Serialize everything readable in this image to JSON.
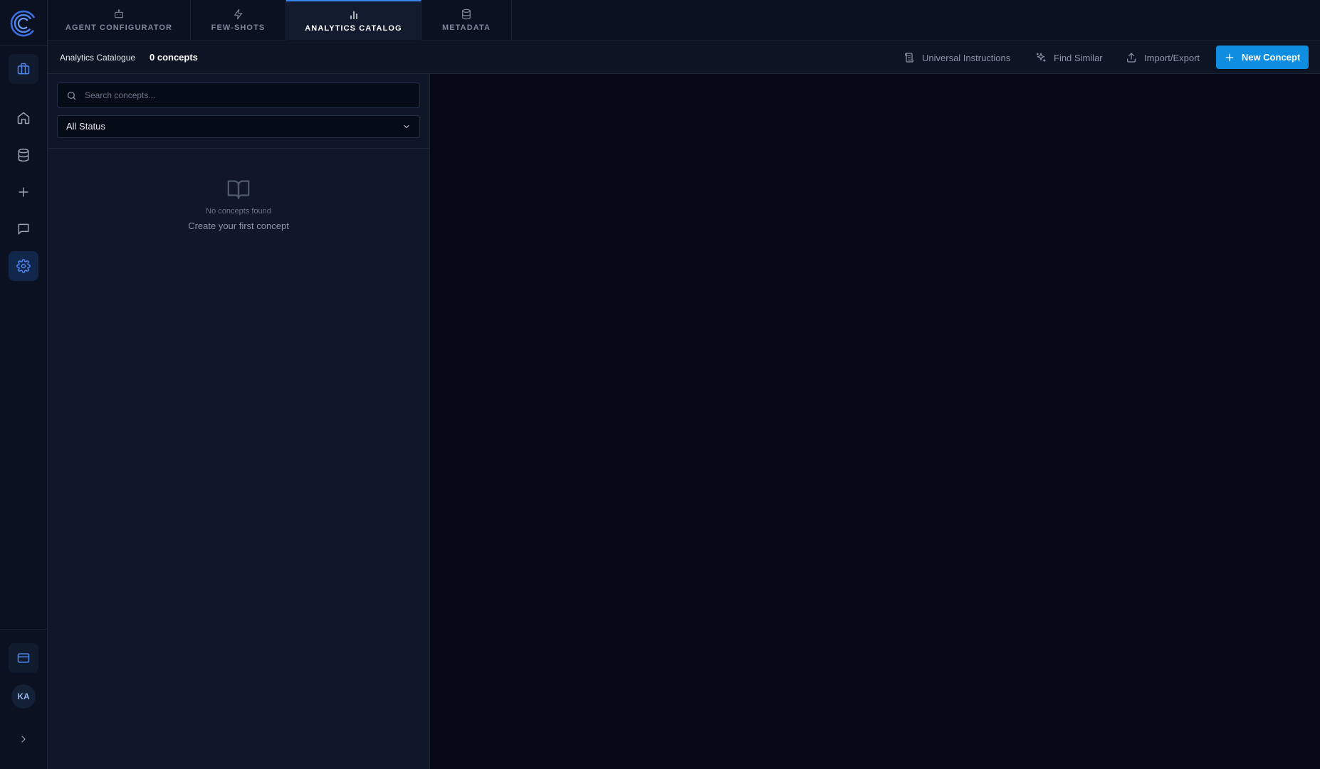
{
  "rail": {
    "logo": "app-logo",
    "items": [
      {
        "name": "briefcase-icon",
        "state": "filled"
      },
      {
        "name": "home-icon",
        "state": "normal"
      },
      {
        "name": "database-icon",
        "state": "normal"
      },
      {
        "name": "plus-icon",
        "state": "normal"
      },
      {
        "name": "chat-icon",
        "state": "normal"
      },
      {
        "name": "gear-icon",
        "state": "active"
      }
    ],
    "bottom_items": [
      {
        "name": "credit-card-icon",
        "state": "filled"
      },
      {
        "name": "chevron-right-icon",
        "state": "normal"
      }
    ],
    "avatar_initials": "KA"
  },
  "tabs": [
    {
      "label": "AGENT CONFIGURATOR",
      "icon": "robot-icon",
      "active": false
    },
    {
      "label": "FEW-SHOTS",
      "icon": "lightning-icon",
      "active": false
    },
    {
      "label": "ANALYTICS CATALOG",
      "icon": "bar-chart-icon",
      "active": true
    },
    {
      "label": "METADATA",
      "icon": "database-icon",
      "active": false
    }
  ],
  "header": {
    "title": "Analytics Catalogue",
    "count": "0 concepts",
    "actions": [
      {
        "label": "Universal Instructions",
        "icon": "scroll-icon"
      },
      {
        "label": "Find Similar",
        "icon": "sparkle-icon"
      },
      {
        "label": "Import/Export",
        "icon": "upload-icon"
      }
    ],
    "primary_button": {
      "label": "New Concept",
      "icon": "plus-icon"
    }
  },
  "panel": {
    "search": {
      "placeholder": "Search concepts...",
      "value": ""
    },
    "status_filter": {
      "selected": "All Status"
    },
    "empty_state": {
      "icon": "book-open-icon",
      "title": "No concepts found",
      "subtitle": "Create your first concept"
    }
  },
  "colors": {
    "accent": "#3b82f6",
    "primary_button": "#0f8de0",
    "background": "#050815",
    "panel": "#0f1729"
  }
}
